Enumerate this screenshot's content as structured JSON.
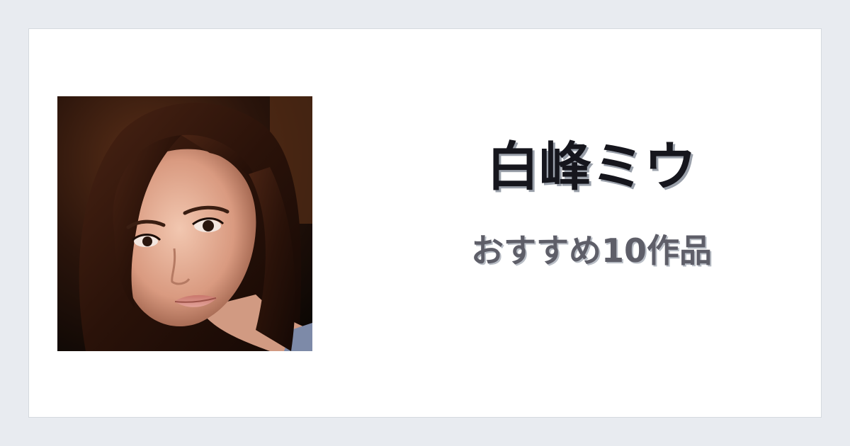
{
  "card": {
    "title": "白峰ミウ",
    "subtitle": "おすすめ10作品"
  },
  "colors": {
    "background": "#e8ebf0",
    "card": "#ffffff",
    "title": "#16161d",
    "subtitle": "#5e5e68"
  }
}
